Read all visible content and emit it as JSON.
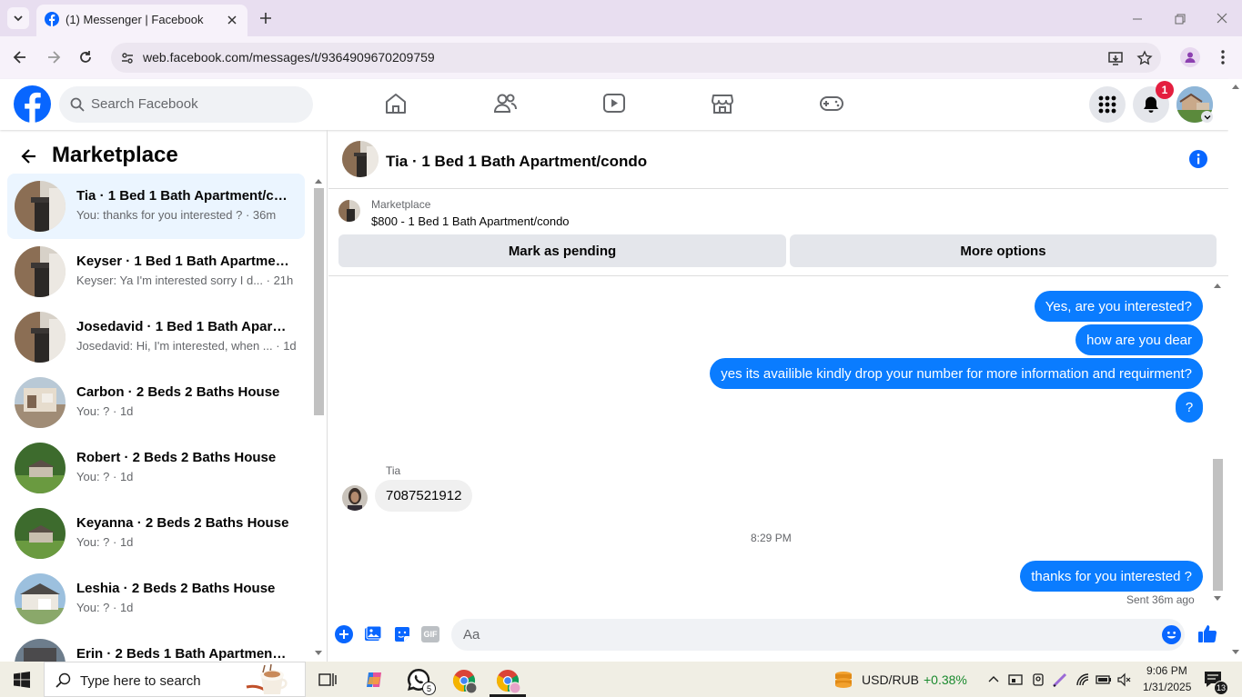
{
  "browser": {
    "tab_title": "(1) Messenger | Facebook",
    "url": "web.facebook.com/messages/t/9364909670209759"
  },
  "header": {
    "search_placeholder": "Search Facebook",
    "notification_count": "1"
  },
  "sidebar": {
    "title": "Marketplace",
    "conversations": [
      {
        "title": "Tia · 1 Bed 1 Bath Apartment/co...",
        "preview": "You: thanks for you interested ? · 36m"
      },
      {
        "title": "Keyser · 1 Bed 1 Bath Apartment...",
        "preview": "Keyser: Ya I'm interested sorry I d... · 21h"
      },
      {
        "title": "Josedavid · 1 Bed 1 Bath Apartm...",
        "preview": "Josedavid: Hi, I'm interested, when ... · 1d"
      },
      {
        "title": "Carbon · 2 Beds 2 Baths House",
        "preview": "You: ? · 1d"
      },
      {
        "title": "Robert · 2 Beds 2 Baths House",
        "preview": "You: ? · 1d"
      },
      {
        "title": "Keyanna · 2 Beds 2 Baths House",
        "preview": "You: ? · 1d"
      },
      {
        "title": "Leshia · 2 Beds 2 Baths House",
        "preview": "You: ? · 1d"
      },
      {
        "title": "Erin · 2 Beds 1 Bath Apartment/...",
        "preview": ""
      }
    ]
  },
  "chat": {
    "title": "Tia · 1 Bed 1 Bath Apartment/condo",
    "marketplace_label": "Marketplace",
    "listing": "$800 - 1 Bed 1 Bath Apartment/condo",
    "mark_pending": "Mark as pending",
    "more_options": "More options",
    "messages_out_1": [
      "Yes, are you interested?",
      "how are you dear",
      "yes its availible kindly drop your number for more information and requirment?",
      "?"
    ],
    "sender_name": "Tia",
    "incoming": "7087521912",
    "timestamp": "8:29 PM",
    "last_out": "thanks for you interested ?",
    "sent_status": "Sent 36m ago",
    "composer_placeholder": "Aa",
    "gif_label": "GIF"
  },
  "taskbar": {
    "search_placeholder": "Type here to search",
    "whatsapp_badge": "5",
    "currency": "USD/RUB",
    "currency_change": "+0.38%",
    "time": "9:06 PM",
    "date": "1/31/2025",
    "notif_count": "13"
  },
  "colors": {
    "fb_blue": "#0866ff",
    "bubble_blue": "#0a7cff",
    "positive_green": "#1a8a2e"
  }
}
